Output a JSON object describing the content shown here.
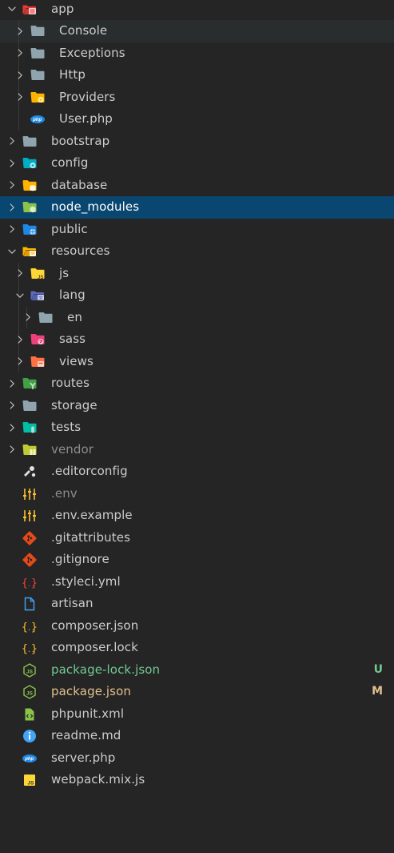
{
  "explorer": {
    "items": [
      {
        "label": "app",
        "depth": 0,
        "type": "folder",
        "expanded": true,
        "icon": "folder-app-icon",
        "color": "#e53935"
      },
      {
        "label": "Console",
        "depth": 1,
        "type": "folder",
        "expanded": false,
        "icon": "folder-icon",
        "color": "#90a4ae",
        "state": "hover"
      },
      {
        "label": "Exceptions",
        "depth": 1,
        "type": "folder",
        "expanded": false,
        "icon": "folder-icon",
        "color": "#90a4ae"
      },
      {
        "label": "Http",
        "depth": 1,
        "type": "folder",
        "expanded": false,
        "icon": "folder-icon",
        "color": "#90a4ae"
      },
      {
        "label": "Providers",
        "depth": 1,
        "type": "folder",
        "expanded": false,
        "icon": "folder-providers-icon",
        "color": "#ffb300"
      },
      {
        "label": "User.php",
        "depth": 1,
        "type": "file",
        "icon": "php-file-icon",
        "color": "#1e88e5"
      },
      {
        "label": "bootstrap",
        "depth": 0,
        "type": "folder",
        "expanded": false,
        "icon": "folder-icon",
        "color": "#90a4ae"
      },
      {
        "label": "config",
        "depth": 0,
        "type": "folder",
        "expanded": false,
        "icon": "folder-config-icon",
        "color": "#00acc1"
      },
      {
        "label": "database",
        "depth": 0,
        "type": "folder",
        "expanded": false,
        "icon": "folder-database-icon",
        "color": "#ffb300"
      },
      {
        "label": "node_modules",
        "depth": 0,
        "type": "folder",
        "expanded": false,
        "icon": "folder-node-icon",
        "color": "#8bc34a",
        "state": "selected"
      },
      {
        "label": "public",
        "depth": 0,
        "type": "folder",
        "expanded": false,
        "icon": "folder-public-icon",
        "color": "#1e88e5"
      },
      {
        "label": "resources",
        "depth": 0,
        "type": "folder",
        "expanded": true,
        "icon": "folder-resources-icon",
        "color": "#ffb300"
      },
      {
        "label": "js",
        "depth": 1,
        "type": "folder",
        "expanded": false,
        "icon": "folder-js-icon",
        "color": "#fdd835"
      },
      {
        "label": "lang",
        "depth": 1,
        "type": "folder",
        "expanded": true,
        "icon": "folder-lang-icon",
        "color": "#5c6bc0"
      },
      {
        "label": "en",
        "depth": 2,
        "type": "folder",
        "expanded": false,
        "icon": "folder-icon",
        "color": "#90a4ae"
      },
      {
        "label": "sass",
        "depth": 1,
        "type": "folder",
        "expanded": false,
        "icon": "folder-sass-icon",
        "color": "#ec407a"
      },
      {
        "label": "views",
        "depth": 1,
        "type": "folder",
        "expanded": false,
        "icon": "folder-views-icon",
        "color": "#ff7043"
      },
      {
        "label": "routes",
        "depth": 0,
        "type": "folder",
        "expanded": false,
        "icon": "folder-routes-icon",
        "color": "#43a047"
      },
      {
        "label": "storage",
        "depth": 0,
        "type": "folder",
        "expanded": false,
        "icon": "folder-icon",
        "color": "#90a4ae"
      },
      {
        "label": "tests",
        "depth": 0,
        "type": "folder",
        "expanded": false,
        "icon": "folder-tests-icon",
        "color": "#00bfa5"
      },
      {
        "label": "vendor",
        "depth": 0,
        "type": "folder",
        "expanded": false,
        "icon": "folder-vendor-icon",
        "color": "#c0ca33",
        "dim": true
      },
      {
        "label": ".editorconfig",
        "depth": 0,
        "type": "file",
        "icon": "editorconfig-icon",
        "color": "#e0e0e0"
      },
      {
        "label": ".env",
        "depth": 0,
        "type": "file",
        "icon": "env-tune-icon",
        "color": "#fbc02d",
        "dim": true
      },
      {
        "label": ".env.example",
        "depth": 0,
        "type": "file",
        "icon": "env-tune-icon",
        "color": "#fbc02d"
      },
      {
        "label": ".gitattributes",
        "depth": 0,
        "type": "file",
        "icon": "git-icon",
        "color": "#e64a19"
      },
      {
        "label": ".gitignore",
        "depth": 0,
        "type": "file",
        "icon": "git-icon",
        "color": "#e64a19"
      },
      {
        "label": ".styleci.yml",
        "depth": 0,
        "type": "file",
        "icon": "yaml-braces-icon",
        "color": "#f44336"
      },
      {
        "label": "artisan",
        "depth": 0,
        "type": "file",
        "icon": "document-icon",
        "color": "#42a5f5"
      },
      {
        "label": "composer.json",
        "depth": 0,
        "type": "file",
        "icon": "json-braces-icon",
        "color": "#fbc02d"
      },
      {
        "label": "composer.lock",
        "depth": 0,
        "type": "file",
        "icon": "json-braces-icon",
        "color": "#fbc02d"
      },
      {
        "label": "package-lock.json",
        "depth": 0,
        "type": "file",
        "icon": "nodejs-icon",
        "color": "#8bc34a",
        "git": "added",
        "badge": "U"
      },
      {
        "label": "package.json",
        "depth": 0,
        "type": "file",
        "icon": "nodejs-icon",
        "color": "#8bc34a",
        "git": "modified",
        "badge": "M"
      },
      {
        "label": "phpunit.xml",
        "depth": 0,
        "type": "file",
        "icon": "xml-icon",
        "color": "#8bc34a"
      },
      {
        "label": "readme.md",
        "depth": 0,
        "type": "file",
        "icon": "info-icon",
        "color": "#42a5f5"
      },
      {
        "label": "server.php",
        "depth": 0,
        "type": "file",
        "icon": "php-file-icon",
        "color": "#1e88e5"
      },
      {
        "label": "webpack.mix.js",
        "depth": 0,
        "type": "file",
        "icon": "javascript-icon",
        "color": "#fdd835"
      }
    ]
  }
}
